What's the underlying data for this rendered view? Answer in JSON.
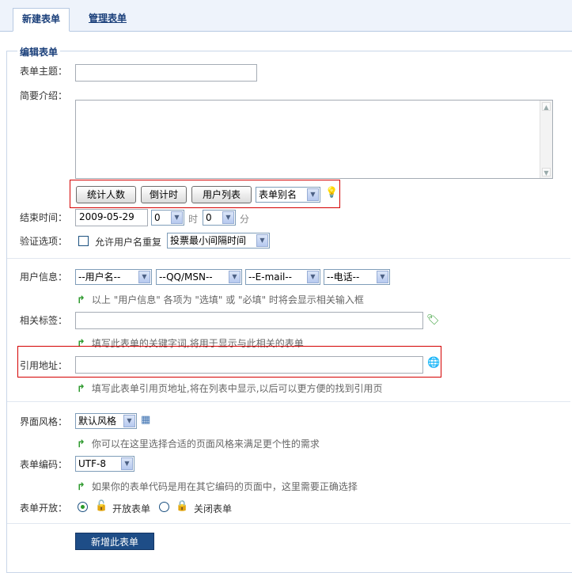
{
  "tabs": {
    "active": "新建表单",
    "manage": "管理表单"
  },
  "legend": "编辑表单",
  "fields": {
    "subject_label": "表单主题：",
    "intro_label": "简要介绍：",
    "end_time_label": "结束时间：",
    "end_date": "2009-05-29",
    "hour": "0",
    "hour_unit": "时",
    "minute": "0",
    "minute_unit": "分",
    "verify_label": "验证选项：",
    "allow_dup": "允许用户名重复",
    "vote_interval": "投票最小间隔时间",
    "userinfo_label": "用户信息：",
    "userinfo_options": [
      "--用户名--",
      "--QQ/MSN--",
      "--E-mail--",
      "--电话--"
    ],
    "userinfo_hint": "以上 \"用户信息\" 各项为 \"选填\" 或 \"必填\" 时将会显示相关输入框",
    "tags_label": "相关标签：",
    "tags_hint": "填写此表单的关键字词,将用于显示与此相关的表单",
    "ref_label": "引用地址：",
    "ref_hint": "填写此表单引用页地址,将在列表中显示,以后可以更方便的找到引用页",
    "style_label": "界面风格：",
    "style_value": "默认风格",
    "style_hint": "你可以在这里选择合适的页面风格来满足更个性的需求",
    "encoding_label": "表单编码：",
    "encoding_value": "UTF-8",
    "encoding_hint": "如果你的表单代码是用在其它编码的页面中，这里需要正确选择",
    "open_label": "表单开放：",
    "open_on": "开放表单",
    "open_off": "关闭表单"
  },
  "toolbar": {
    "count_btn": "统计人数",
    "countdown_btn": "倒计时",
    "userlist_btn": "用户列表",
    "alias_select": "表单别名"
  },
  "submit_label": "新增此表单",
  "colors": {
    "accent": "#1e4d87",
    "highlight": "#d40000",
    "hint_arrow": "#2f9a2f"
  }
}
